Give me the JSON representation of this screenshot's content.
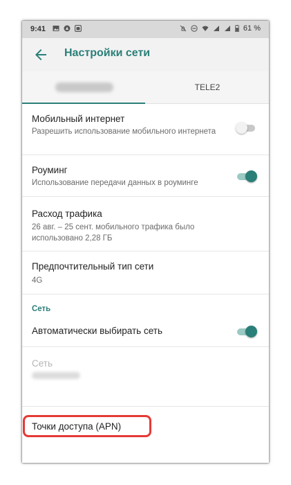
{
  "status_bar": {
    "time": "9:41",
    "battery_text": "61 %"
  },
  "app_bar": {
    "title": "Настройки сети",
    "back_icon": "arrow-back-icon"
  },
  "tabs": [
    {
      "label": "",
      "selected": true,
      "redacted": true
    },
    {
      "label": "TELE2",
      "selected": false
    }
  ],
  "settings": {
    "mobile_data": {
      "title": "Мобильный интернет",
      "summary": "Разрешить использование мобильного интернета",
      "enabled": false
    },
    "roaming": {
      "title": "Роуминг",
      "summary": "Использование передачи данных в роуминге",
      "enabled": true
    },
    "data_usage": {
      "title": "Расход трафика",
      "summary": "26 авг. – 25 сент. мобильного трафика было использовано 2,28 ГБ"
    },
    "network_type": {
      "title": "Предпочтительный тип сети",
      "summary": "4G"
    },
    "network_section": {
      "header": "Сеть",
      "auto_select": {
        "title": "Автоматически выбирать сеть",
        "enabled": true
      },
      "network": {
        "title": "Сеть"
      }
    },
    "apn": {
      "title": "Точки доступа (APN)"
    }
  },
  "colors": {
    "accent": "#2a7f78",
    "highlight": "#e53935"
  }
}
